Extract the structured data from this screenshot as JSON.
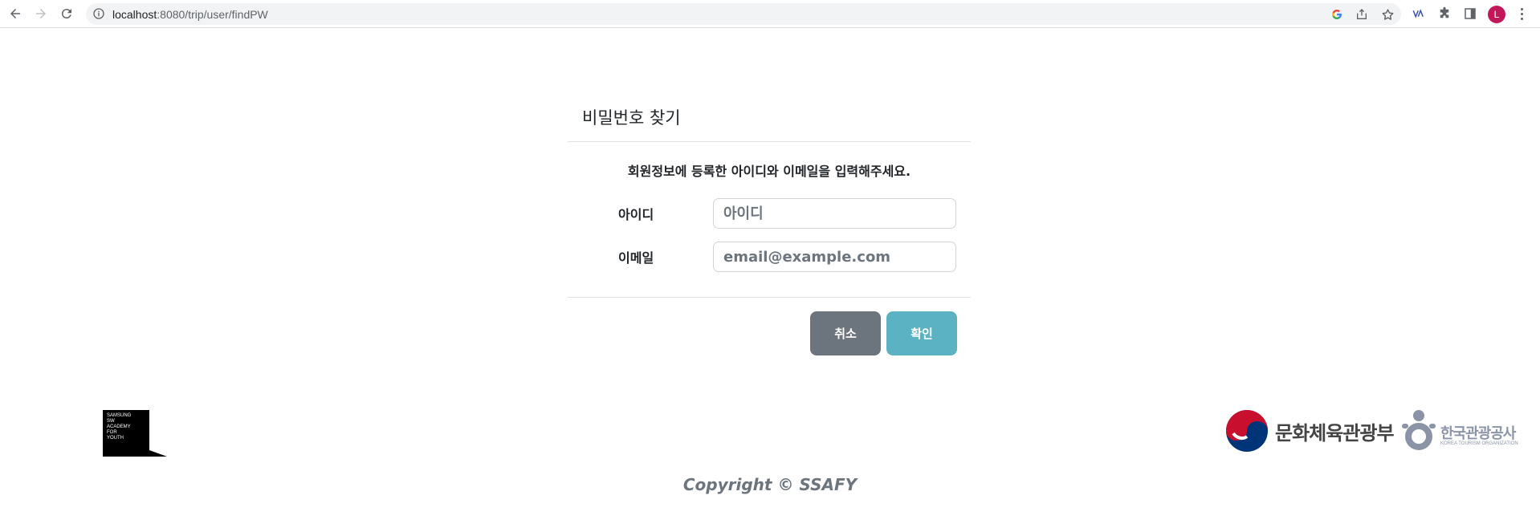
{
  "browser": {
    "url_host": "localhost",
    "url_path": ":8080/trip/user/findPW",
    "avatar_letter": "L"
  },
  "card": {
    "title": "비밀번호 찾기",
    "subtitle": "회원정보에 등록한 아이디와 이메일을 입력해주세요.",
    "id_label": "아이디",
    "id_placeholder": "아이디",
    "email_label": "이메일",
    "email_placeholder": "email@example.com",
    "cancel_label": "취소",
    "confirm_label": "확인"
  },
  "footer": {
    "ssafy_logo_lines": [
      "SAMSUNG",
      "SW",
      "ACADEMY",
      "FOR",
      "YOUTH"
    ],
    "ministry_name": "문화체육관광부",
    "kto_name": "한국관광공사",
    "kto_english": "KOREA TOURISM ORGANIZATION",
    "copyright": "Copyright © SSAFY"
  },
  "colors": {
    "cancel": "#6c757d",
    "confirm": "#5bb2c3",
    "ministry_red": "#c8102e",
    "ministry_blue": "#003478",
    "kto_gray": "#8a94a6"
  }
}
